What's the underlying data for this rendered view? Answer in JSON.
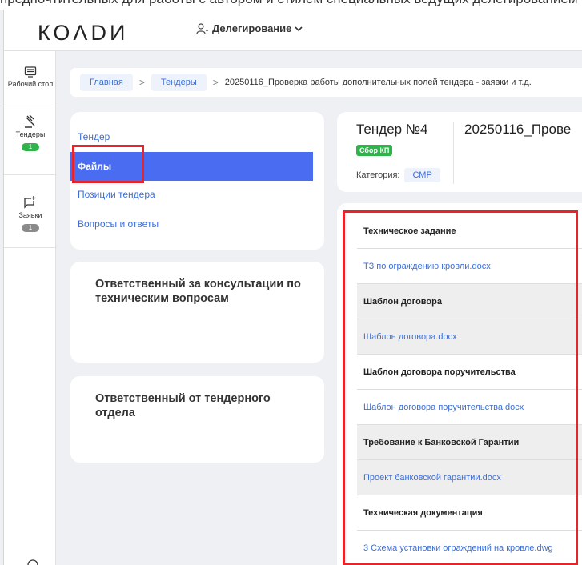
{
  "top_strip_text": "предпочтительных для работы с автором и стилем специальных ведущих делегированием",
  "header": {
    "logo": "КОΛDИ",
    "delegation_label": "Делегирование"
  },
  "sidebar": {
    "items": [
      {
        "label": "Рабочий стол",
        "badge": null
      },
      {
        "label": "Тендеры",
        "badge": "1"
      },
      {
        "label": "Заявки",
        "badge": "1"
      }
    ]
  },
  "breadcrumb": {
    "home": "Главная",
    "tenders": "Тендеры",
    "current": "20250116_Проверка работы дополнительных полей тендера - заявки и т.д."
  },
  "menu": {
    "items": [
      {
        "label": "Тендер"
      },
      {
        "label": "Файлы"
      },
      {
        "label": "Позиции тендера"
      },
      {
        "label": "Вопросы и ответы"
      }
    ]
  },
  "responsible": {
    "tech": "Ответственный за консультации по техническим вопросам",
    "tender_dept": "Ответственный от тендерного отдела"
  },
  "tender": {
    "number": "Тендер №4",
    "name": "20250116_Прове",
    "status_badge": "Сбор КП",
    "category_label": "Категория:",
    "category_value": "СМР"
  },
  "files": {
    "rows": [
      {
        "text": "Техническое задание",
        "kind": "head",
        "shade": false
      },
      {
        "text": "ТЗ по ограждению кровли.docx",
        "kind": "link",
        "shade": false
      },
      {
        "text": "Шаблон договора",
        "kind": "head",
        "shade": true
      },
      {
        "text": "Шаблон договора.docx",
        "kind": "link",
        "shade": true
      },
      {
        "text": "Шаблон договора поручительства",
        "kind": "head",
        "shade": false
      },
      {
        "text": "Шаблон договора поручительства.docx",
        "kind": "link",
        "shade": false
      },
      {
        "text": "Требование к Банковской Гарантии",
        "kind": "head",
        "shade": true
      },
      {
        "text": "Проект банковской гарантии.docx",
        "kind": "link",
        "shade": true
      },
      {
        "text": "Техническая документация",
        "kind": "head",
        "shade": false
      },
      {
        "text": "3 Схема установки ограждений на кровле.dwg",
        "kind": "link",
        "shade": false
      }
    ]
  },
  "colors": {
    "accent": "#4a6cf0",
    "link": "#3d6fd6",
    "badge_green": "#2fb34a",
    "highlight_red": "#e8242a"
  }
}
